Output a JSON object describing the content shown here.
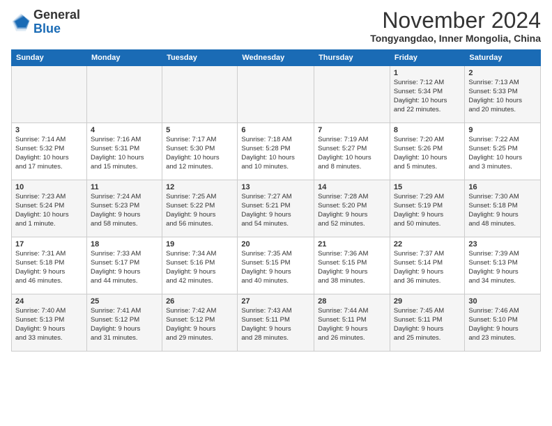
{
  "logo": {
    "text_general": "General",
    "text_blue": "Blue"
  },
  "header": {
    "month_title": "November 2024",
    "location": "Tongyangdao, Inner Mongolia, China"
  },
  "weekdays": [
    "Sunday",
    "Monday",
    "Tuesday",
    "Wednesday",
    "Thursday",
    "Friday",
    "Saturday"
  ],
  "weeks": [
    [
      {
        "day": "",
        "info": ""
      },
      {
        "day": "",
        "info": ""
      },
      {
        "day": "",
        "info": ""
      },
      {
        "day": "",
        "info": ""
      },
      {
        "day": "",
        "info": ""
      },
      {
        "day": "1",
        "info": "Sunrise: 7:12 AM\nSunset: 5:34 PM\nDaylight: 10 hours\nand 22 minutes."
      },
      {
        "day": "2",
        "info": "Sunrise: 7:13 AM\nSunset: 5:33 PM\nDaylight: 10 hours\nand 20 minutes."
      }
    ],
    [
      {
        "day": "3",
        "info": "Sunrise: 7:14 AM\nSunset: 5:32 PM\nDaylight: 10 hours\nand 17 minutes."
      },
      {
        "day": "4",
        "info": "Sunrise: 7:16 AM\nSunset: 5:31 PM\nDaylight: 10 hours\nand 15 minutes."
      },
      {
        "day": "5",
        "info": "Sunrise: 7:17 AM\nSunset: 5:30 PM\nDaylight: 10 hours\nand 12 minutes."
      },
      {
        "day": "6",
        "info": "Sunrise: 7:18 AM\nSunset: 5:28 PM\nDaylight: 10 hours\nand 10 minutes."
      },
      {
        "day": "7",
        "info": "Sunrise: 7:19 AM\nSunset: 5:27 PM\nDaylight: 10 hours\nand 8 minutes."
      },
      {
        "day": "8",
        "info": "Sunrise: 7:20 AM\nSunset: 5:26 PM\nDaylight: 10 hours\nand 5 minutes."
      },
      {
        "day": "9",
        "info": "Sunrise: 7:22 AM\nSunset: 5:25 PM\nDaylight: 10 hours\nand 3 minutes."
      }
    ],
    [
      {
        "day": "10",
        "info": "Sunrise: 7:23 AM\nSunset: 5:24 PM\nDaylight: 10 hours\nand 1 minute."
      },
      {
        "day": "11",
        "info": "Sunrise: 7:24 AM\nSunset: 5:23 PM\nDaylight: 9 hours\nand 58 minutes."
      },
      {
        "day": "12",
        "info": "Sunrise: 7:25 AM\nSunset: 5:22 PM\nDaylight: 9 hours\nand 56 minutes."
      },
      {
        "day": "13",
        "info": "Sunrise: 7:27 AM\nSunset: 5:21 PM\nDaylight: 9 hours\nand 54 minutes."
      },
      {
        "day": "14",
        "info": "Sunrise: 7:28 AM\nSunset: 5:20 PM\nDaylight: 9 hours\nand 52 minutes."
      },
      {
        "day": "15",
        "info": "Sunrise: 7:29 AM\nSunset: 5:19 PM\nDaylight: 9 hours\nand 50 minutes."
      },
      {
        "day": "16",
        "info": "Sunrise: 7:30 AM\nSunset: 5:18 PM\nDaylight: 9 hours\nand 48 minutes."
      }
    ],
    [
      {
        "day": "17",
        "info": "Sunrise: 7:31 AM\nSunset: 5:18 PM\nDaylight: 9 hours\nand 46 minutes."
      },
      {
        "day": "18",
        "info": "Sunrise: 7:33 AM\nSunset: 5:17 PM\nDaylight: 9 hours\nand 44 minutes."
      },
      {
        "day": "19",
        "info": "Sunrise: 7:34 AM\nSunset: 5:16 PM\nDaylight: 9 hours\nand 42 minutes."
      },
      {
        "day": "20",
        "info": "Sunrise: 7:35 AM\nSunset: 5:15 PM\nDaylight: 9 hours\nand 40 minutes."
      },
      {
        "day": "21",
        "info": "Sunrise: 7:36 AM\nSunset: 5:15 PM\nDaylight: 9 hours\nand 38 minutes."
      },
      {
        "day": "22",
        "info": "Sunrise: 7:37 AM\nSunset: 5:14 PM\nDaylight: 9 hours\nand 36 minutes."
      },
      {
        "day": "23",
        "info": "Sunrise: 7:39 AM\nSunset: 5:13 PM\nDaylight: 9 hours\nand 34 minutes."
      }
    ],
    [
      {
        "day": "24",
        "info": "Sunrise: 7:40 AM\nSunset: 5:13 PM\nDaylight: 9 hours\nand 33 minutes."
      },
      {
        "day": "25",
        "info": "Sunrise: 7:41 AM\nSunset: 5:12 PM\nDaylight: 9 hours\nand 31 minutes."
      },
      {
        "day": "26",
        "info": "Sunrise: 7:42 AM\nSunset: 5:12 PM\nDaylight: 9 hours\nand 29 minutes."
      },
      {
        "day": "27",
        "info": "Sunrise: 7:43 AM\nSunset: 5:11 PM\nDaylight: 9 hours\nand 28 minutes."
      },
      {
        "day": "28",
        "info": "Sunrise: 7:44 AM\nSunset: 5:11 PM\nDaylight: 9 hours\nand 26 minutes."
      },
      {
        "day": "29",
        "info": "Sunrise: 7:45 AM\nSunset: 5:11 PM\nDaylight: 9 hours\nand 25 minutes."
      },
      {
        "day": "30",
        "info": "Sunrise: 7:46 AM\nSunset: 5:10 PM\nDaylight: 9 hours\nand 23 minutes."
      }
    ]
  ]
}
